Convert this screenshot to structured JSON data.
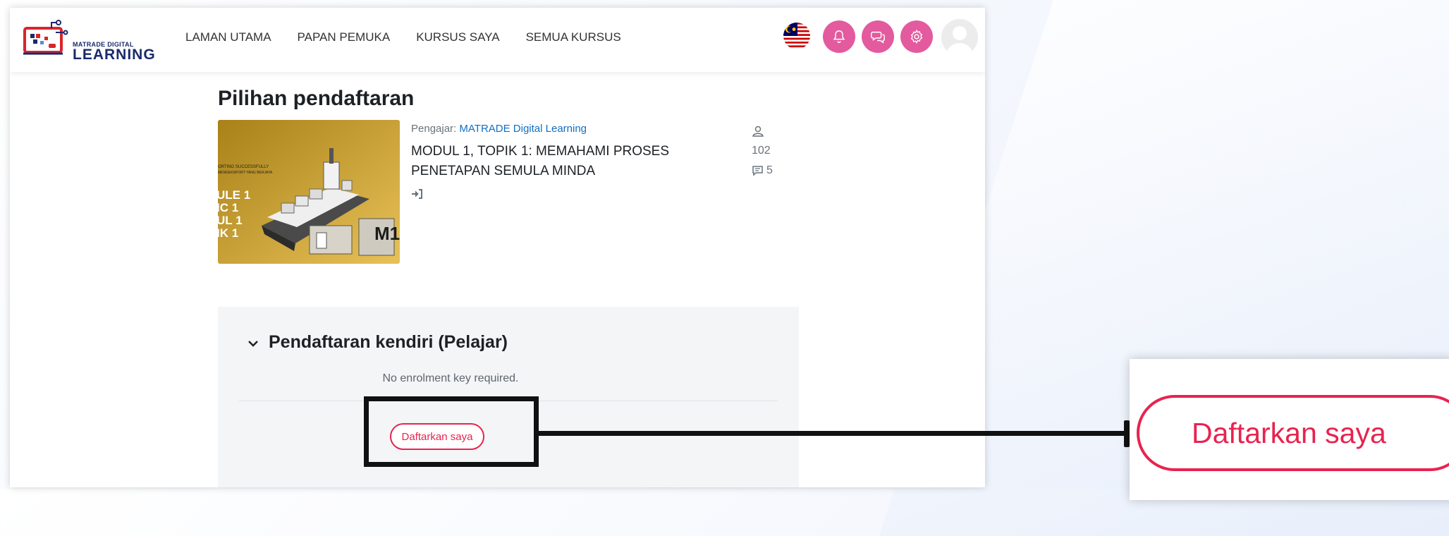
{
  "navbar": {
    "logo_small": "MATRADE DIGITAL",
    "logo_big": "LEARNING",
    "links": [
      "LAMAN UTAMA",
      "PAPAN PEMUKA",
      "KURSUS SAYA",
      "SEMUA KURSUS"
    ],
    "icons": [
      "malaysia-flag-icon",
      "notification-bell-icon",
      "messages-icon",
      "settings-icon",
      "user-avatar-icon"
    ],
    "accent_color": "#e35a9f"
  },
  "page": {
    "title": "Pilihan pendaftaran"
  },
  "course": {
    "teacher_label": "Pengajar:",
    "teacher_name": "MATRADE Digital Learning",
    "name": "MODUL 1, TOPIK 1: MEMAHAMI PROSES PENETAPAN SEMULA MINDA",
    "participants": "102",
    "comments": "5",
    "thumbnail": {
      "tagline_1": "ORTING SUCCESSFULLY",
      "tagline_2": "MENGEKSPORT YANG BERJAYA",
      "module_lines": [
        "ULE 1",
        "IC 1",
        "UL 1",
        "IK 1"
      ],
      "badge": "M1",
      "background_color": "#e0ac20"
    }
  },
  "enrolment": {
    "title": "Pendaftaran kendiri (Pelajar)",
    "note": "No enrolment key required.",
    "button_label": "Daftarkan saya",
    "button_color": "#e8234f"
  },
  "callout": {
    "button_label": "Daftarkan saya"
  }
}
